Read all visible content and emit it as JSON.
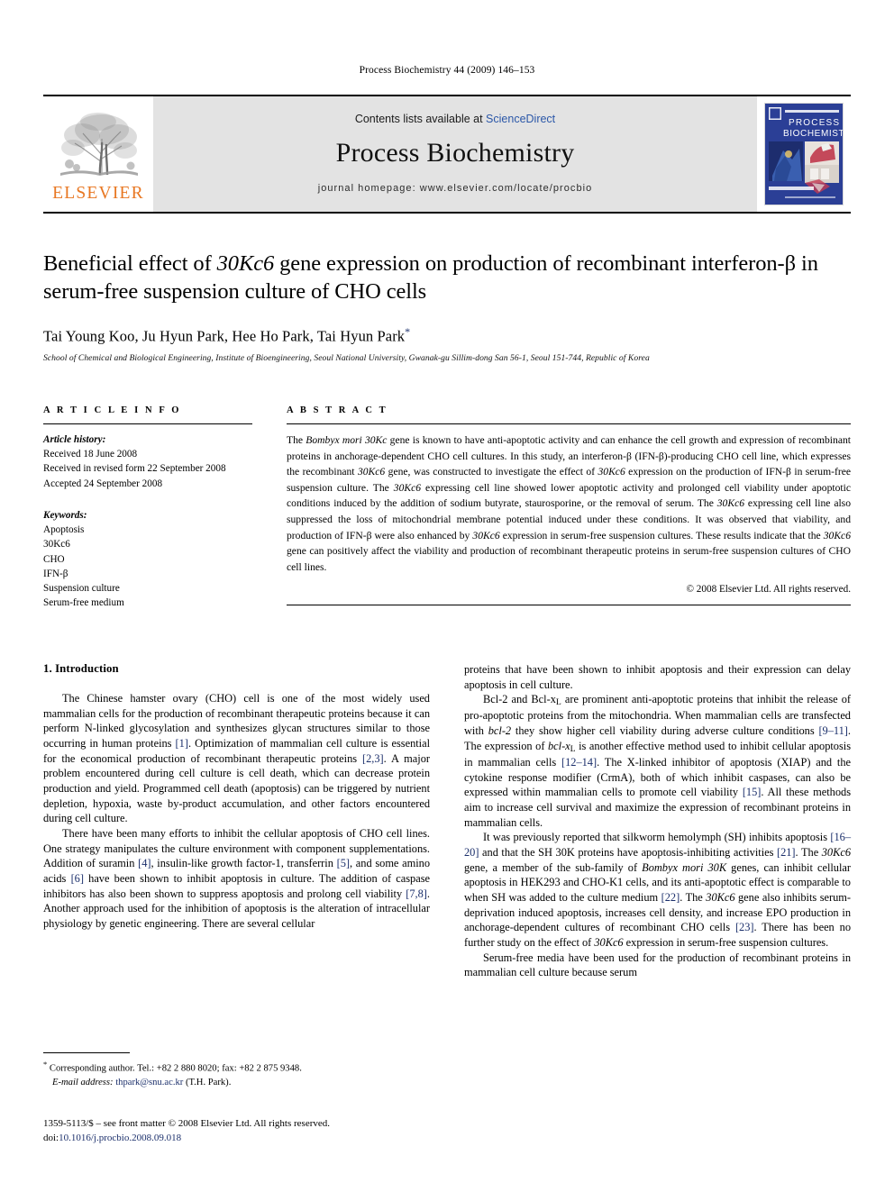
{
  "running_head": "Process Biochemistry 44 (2009) 146–153",
  "masthead": {
    "publisher_logo_word": "ELSEVIER",
    "contents_prefix": "Contents lists available at ",
    "sciencedirect": "ScienceDirect",
    "journal_name": "Process Biochemistry",
    "homepage": "journal homepage: www.elsevier.com/locate/procbio",
    "cover_title_line1": "PROCESS",
    "cover_title_line2": "BIOCHEMISTRY",
    "accent_orange": "#E87722",
    "link_blue": "#2b57a8",
    "cover_blue": "#2b3f96",
    "masthead_grey": "#e3e3e3"
  },
  "article": {
    "title_line1_pre": "Beneficial effect of ",
    "title_italic1": "30Kc6",
    "title_line1_post": " gene expression on production of recombinant",
    "title_line2": "interferon-β in serum-free suspension culture of CHO cells",
    "authors": "Tai Young Koo, Ju Hyun Park, Hee Ho Park, Tai Hyun Park",
    "corresponding_mark": "*",
    "affiliation": "School of Chemical and Biological Engineering, Institute of Bioengineering, Seoul National University, Gwanak-gu Sillim-dong San 56-1, Seoul 151-744, Republic of Korea"
  },
  "article_info": {
    "heading": "A R T I C L E   I N F O",
    "history_label": "Article history:",
    "history": [
      "Received 18 June 2008",
      "Received in revised form 22 September 2008",
      "Accepted 24 September 2008"
    ],
    "keywords_label": "Keywords:",
    "keywords": [
      "Apoptosis",
      "30Kc6",
      "CHO",
      "IFN-β",
      "Suspension culture",
      "Serum-free medium"
    ]
  },
  "abstract": {
    "heading": "A B S T R A C T",
    "seg1": "The ",
    "seg1_italic": "Bombyx mori 30Kc",
    "seg2": " gene is known to have anti-apoptotic activity and can enhance the cell growth and expression of recombinant proteins in anchorage-dependent CHO cell cultures. In this study, an interferon-β (IFN-β)-producing CHO cell line, which expresses the recombinant ",
    "seg2_italic": "30Kc6",
    "seg3": " gene, was constructed to investigate the effect of ",
    "seg3_italic": "30Kc6",
    "seg4": " expression on the production of IFN-β in serum-free suspension culture. The ",
    "seg4_italic": "30Kc6",
    "seg5": " expressing cell line showed lower apoptotic activity and prolonged cell viability under apoptotic conditions induced by the addition of sodium butyrate, staurosporine, or the removal of serum. The ",
    "seg5_italic": "30Kc6",
    "seg6": " expressing cell line also suppressed the loss of mitochondrial membrane potential induced under these conditions. It was observed that viability, and production of IFN-β were also enhanced by ",
    "seg6_italic": "30Kc6",
    "seg7": " expression in serum-free suspension cultures. These results indicate that the ",
    "seg7_italic": "30Kc6",
    "seg8": " gene can positively affect the viability and production of recombinant therapeutic proteins in serum-free suspension cultures of CHO cell lines.",
    "copyright": "© 2008 Elsevier Ltd. All rights reserved."
  },
  "body": {
    "intro_heading": "1. Introduction",
    "left_col": {
      "p1_a": "The Chinese hamster ovary (CHO) cell is one of the most widely used mammalian cells for the production of recombinant therapeutic proteins because it can perform N-linked glycosylation and synthesizes glycan structures similar to those occurring in human proteins ",
      "p1_ref1": "[1]",
      "p1_b": ". Optimization of mammalian cell culture is essential for the economical production of recombinant therapeutic proteins ",
      "p1_ref2": "[2,3]",
      "p1_c": ". A major problem encountered during cell culture is cell death, which can decrease protein production and yield. Programmed cell death (apoptosis) can be triggered by nutrient depletion, hypoxia, waste by-product accumulation, and other factors encountered during cell culture.",
      "p2_a": "There have been many efforts to inhibit the cellular apoptosis of CHO cell lines. One strategy manipulates the culture environment with component supplementations. Addition of suramin ",
      "p2_ref1": "[4]",
      "p2_b": ", insulin-like growth factor-1, transferrin ",
      "p2_ref2": "[5]",
      "p2_c": ", and some amino acids ",
      "p2_ref3": "[6]",
      "p2_d": " have been shown to inhibit apoptosis in culture. The addition of caspase inhibitors has also been shown to suppress apoptosis and prolong cell viability ",
      "p2_ref4": "[7,8]",
      "p2_e": ". Another approach used for the inhibition of apoptosis is the alteration of intracellular physiology by genetic engineering. There are several cellular"
    },
    "right_col": {
      "p0": "proteins that have been shown to inhibit apoptosis and their expression can delay apoptosis in cell culture.",
      "p1_a": "Bcl-2 and Bcl-x",
      "p1_sub1": "L",
      "p1_b": " are prominent anti-apoptotic proteins that inhibit the release of pro-apoptotic proteins from the mitochondria. When mammalian cells are transfected with ",
      "p1_ital1": "bcl-2",
      "p1_c": " they show higher cell viability during adverse culture conditions ",
      "p1_ref1": "[9–11]",
      "p1_d": ". The expression of ",
      "p1_ital2": "bcl-x",
      "p1_sub2": "L",
      "p1_e": " is another effective method used to inhibit cellular apoptosis in mammalian cells ",
      "p1_ref2": "[12–14]",
      "p1_f": ". The X-linked inhibitor of apoptosis (XIAP) and the cytokine response modifier (CrmA), both of which inhibit caspases, can also be expressed within mammalian cells to promote cell viability ",
      "p1_ref3": "[15]",
      "p1_g": ". All these methods aim to increase cell survival and maximize the expression of recombinant proteins in mammalian cells.",
      "p2_a": "It was previously reported that silkworm hemolymph (SH) inhibits apoptosis ",
      "p2_ref1": "[16–20]",
      "p2_b": " and that the SH 30K proteins have apoptosis-inhibiting activities ",
      "p2_ref2": "[21]",
      "p2_c": ". The ",
      "p2_ital1": "30Kc6",
      "p2_d": " gene, a member of the sub-family of ",
      "p2_ital2": "Bombyx mori 30K",
      "p2_e": " genes, can inhibit cellular apoptosis in HEK293 and CHO-K1 cells, and its anti-apoptotic effect is comparable to when SH was added to the culture medium ",
      "p2_ref3": "[22]",
      "p2_f": ". The ",
      "p2_ital3": "30Kc6",
      "p2_g": " gene also inhibits serum-deprivation induced apoptosis, increases cell density, and increase EPO production in anchorage-dependent cultures of recombinant CHO cells ",
      "p2_ref4": "[23]",
      "p2_h": ". There has been no further study on the effect of ",
      "p2_ital4": "30Kc6",
      "p2_i": " expression in serum-free suspension cultures.",
      "p3": "Serum-free media have been used for the production of recombinant proteins in mammalian cell culture because serum"
    }
  },
  "footnote": {
    "star": "*",
    "corresponding": " Corresponding author. Tel.: +82 2 880 8020; fax: +82 2 875 9348.",
    "email_label": "E-mail address:",
    "email": "thpark@snu.ac.kr",
    "email_suffix": " (T.H. Park)."
  },
  "imprint": {
    "line1": "1359-5113/$ – see front matter © 2008 Elsevier Ltd. All rights reserved.",
    "doi_label": "doi:",
    "doi_value": "10.1016/j.procbio.2008.09.018"
  }
}
